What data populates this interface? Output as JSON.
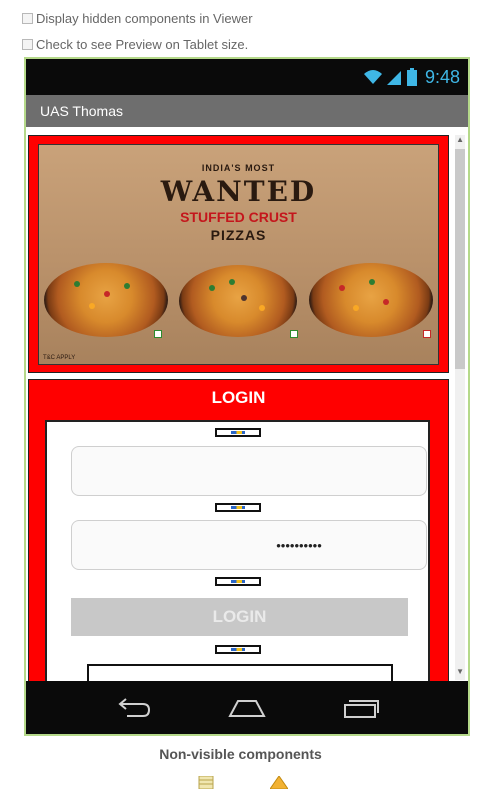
{
  "viewer_options": {
    "hidden_components_label": "Display hidden components in Viewer",
    "tablet_preview_label": "Check to see Preview on Tablet size."
  },
  "status_bar": {
    "time": "9:48",
    "icons": [
      "wifi-icon",
      "signal-icon",
      "battery-icon"
    ],
    "color": "#3fb7e6"
  },
  "screen": {
    "title": "UAS Thomas"
  },
  "banner": {
    "top_line": "INDIA'S MOST",
    "headline": "WANTED",
    "subline": "STUFFED CRUST",
    "bottom_line": "PIZZAS",
    "fine_print": "T&C APPLY"
  },
  "login": {
    "title": "LOGIN",
    "username_value": "",
    "password_value": "••••••••••",
    "button_label": "LOGIN"
  },
  "nav_bar": {
    "icons": [
      "back-icon",
      "home-icon",
      "recents-icon"
    ]
  },
  "non_visible": {
    "label": "Non-visible components",
    "icons": [
      "database-icon",
      "notifier-icon"
    ]
  },
  "colors": {
    "panel_red": "#ff0000",
    "title_bar": "#6e6e6e",
    "frame_border": "#b5d98a",
    "button_disabled": "#c8c8c8"
  }
}
